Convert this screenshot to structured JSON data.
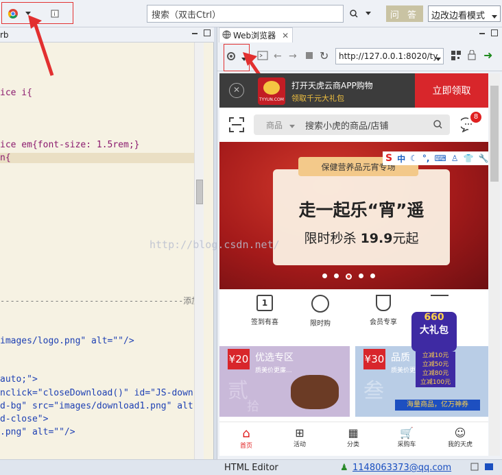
{
  "toolbar": {
    "search_placeholder": "搜索（双击Ctrl）",
    "ask_label": "问 答",
    "mode_label": "边改边看模式"
  },
  "editor": {
    "tab_label": "rb",
    "lines": [
      {
        "text": "ice i{"
      },
      {
        "text": "ice em{font-size: 1.5rem;}"
      },
      {
        "text": "n{"
      },
      {
        "text": "-------------------------------------添加"
      },
      {
        "text": "images/logo.png\" alt=\"\"/>"
      },
      {
        "text": "auto;\">"
      },
      {
        "text": "nclick=\"closeDownload()\" id=\"JS-down"
      },
      {
        "text": "d-bg\" src=\"images/download1.png\" alt"
      },
      {
        "text": "d-close\">"
      },
      {
        "text": ".png\" alt=\"\"/>"
      }
    ]
  },
  "browser": {
    "tab_label": "Web浏览器",
    "url": "http://127.0.0.1:8020/ty",
    "app_banner": {
      "title": "打开天虎云商APP购物",
      "subtitle": "领取千元大礼包",
      "logo_text": "TYYUN.COM",
      "cta": "立即领取"
    },
    "search": {
      "category": "商品",
      "placeholder": "搜索小虎的商品/店铺",
      "badge": "8"
    },
    "promo": {
      "tag": "保健营养品元宵专场",
      "headline": "走一起乐“宵”遥",
      "subline_prefix": "限时秒杀 ",
      "price": "19.9",
      "subline_suffix": "元起"
    },
    "ime_bar": {
      "label": "中"
    },
    "icons": [
      {
        "label": "签到有喜",
        "glyph": "1"
      },
      {
        "label": "限时购"
      },
      {
        "label": "会员专享"
      },
      {
        "label": ""
      }
    ],
    "coupons": [
      {
        "price": "¥20",
        "title": "优选专区",
        "subtitle": "质美价更廉...",
        "bg_char": "贰",
        "bg_char2": "拾"
      },
      {
        "price": "¥30",
        "title": "品质",
        "subtitle": "质美价更廉",
        "bg_char": "叁"
      }
    ],
    "gift_popup": {
      "top": "660",
      "title": "大礼包",
      "lines": [
        "立减10元",
        "立减50元",
        "立减80元",
        "立减100元"
      ],
      "footer": "海量商品，亿万神券"
    },
    "bottom_nav": [
      {
        "label": "首页"
      },
      {
        "label": "活动"
      },
      {
        "label": "分类"
      },
      {
        "label": "采购车"
      },
      {
        "label": "我的天虎"
      }
    ]
  },
  "watermark": "http://blog.csdn.net/",
  "status": {
    "mode": "HTML Editor",
    "email": "1148063373@qq.com"
  },
  "colors": {
    "accent_red": "#e23030",
    "promo_red": "#b2201e",
    "gold": "#c9c3a3"
  }
}
